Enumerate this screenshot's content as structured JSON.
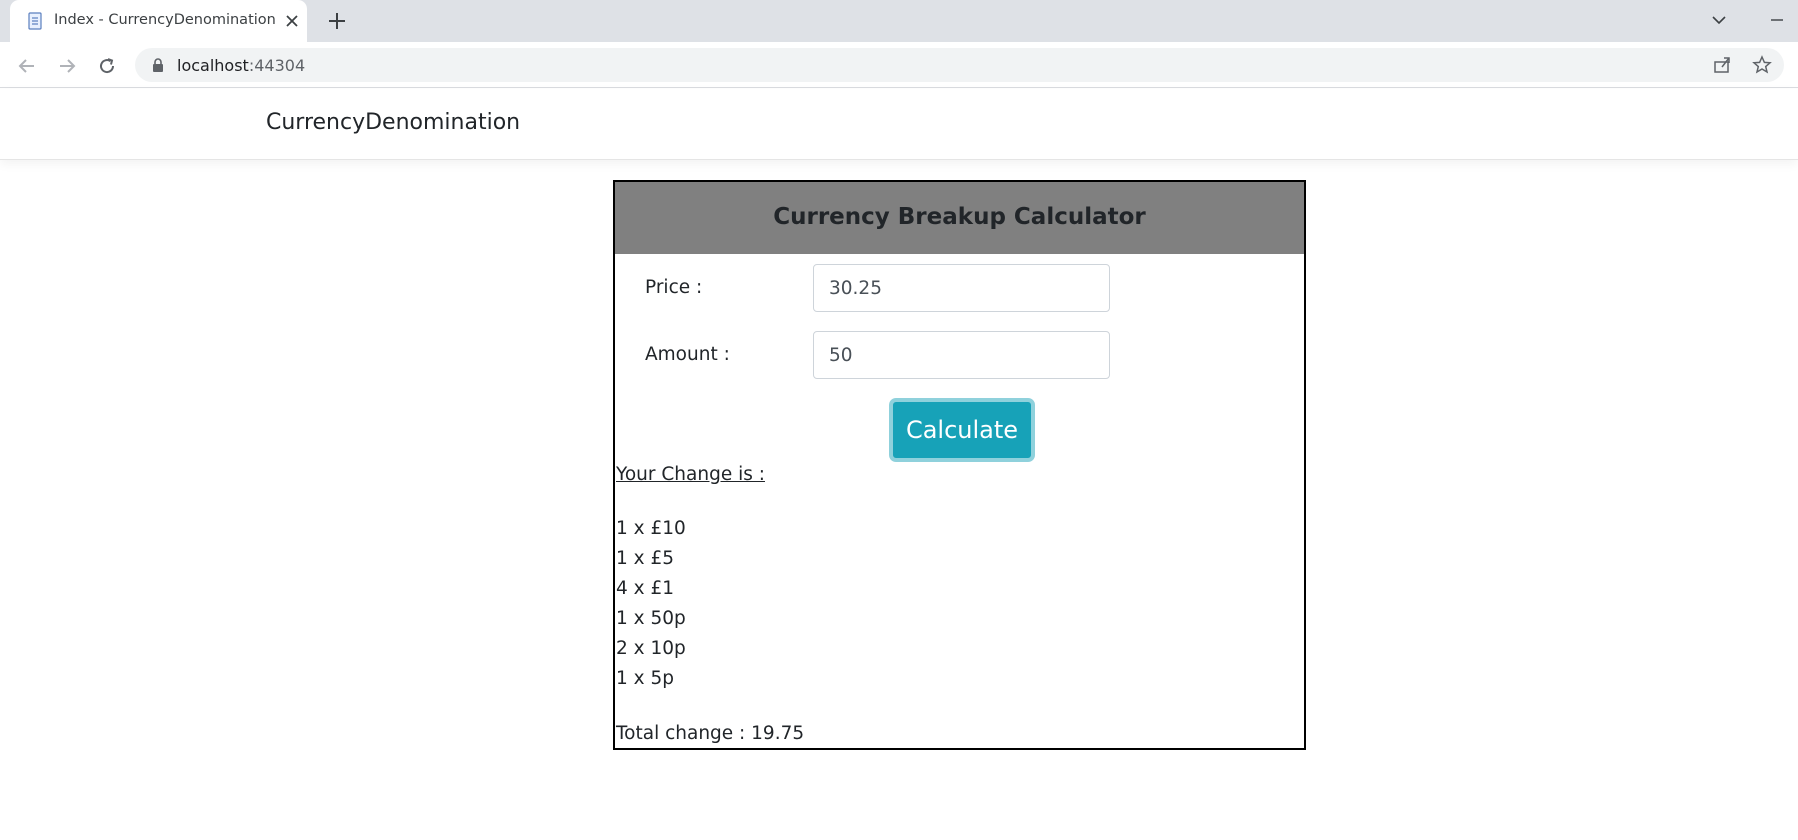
{
  "browser": {
    "tab_title": "Index - CurrencyDenomination",
    "url_host": "localhost",
    "url_port": ":44304"
  },
  "site": {
    "brand": "CurrencyDenomination"
  },
  "calculator": {
    "title": "Currency Breakup Calculator",
    "price_label": "Price :",
    "price_value": "30.25",
    "amount_label": "Amount :",
    "amount_value": "50",
    "calculate_label": "Calculate",
    "change_heading": "Your Change is :",
    "change_items": [
      "1 x £10",
      "1 x £5",
      "4 x £1",
      "1 x 50p",
      "2 x 10p",
      "1 x 5p"
    ],
    "total_text": "Total change : 19.75"
  },
  "colors": {
    "header_bg": "#808080",
    "button_bg": "#17a2b8",
    "tabstrip_bg": "#dee1e6"
  },
  "icons": [
    "document-icon",
    "close-icon",
    "plus-icon",
    "chevron-down-icon",
    "minimize-icon",
    "back-arrow-icon",
    "forward-arrow-icon",
    "reload-icon",
    "lock-icon",
    "share-icon",
    "star-icon"
  ]
}
